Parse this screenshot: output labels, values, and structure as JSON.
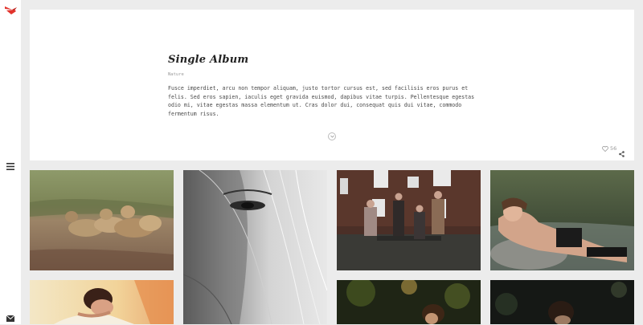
{
  "sidebar": {
    "logo_icon": "bird-logo-icon",
    "menu_icon": "hamburger-menu-icon",
    "contact_icon": "envelope-icon",
    "accent_color": "#e2332c"
  },
  "album": {
    "title": "Single Album",
    "category": "Nature",
    "description": "Fusce imperdiet, arcu non tempor aliquam, justo tortor cursus est, sed facilisis eros purus et felis. Sed eros sapien, iaculis eget gravida euismod, dapibus vitae turpis. Pellentesque egestas odio mi, vitae egestas massa elementum ut. Cras dolor dui, consequat quis dui vitae, commodo fermentum risus.",
    "likes": "56",
    "like_icon": "heart-outline-icon",
    "share_icon": "share-icon",
    "scroll_icon": "chevron-down-circle-icon"
  },
  "gallery": {
    "photos": [
      "lions-on-dirt-road",
      "woman-face-black-and-white",
      "group-of-five-people-on-bench",
      "woman-lying-on-rock-by-water",
      "woman-lying-in-sunlight",
      "woman-in-forest-light",
      "portrait-in-dark-setting"
    ]
  }
}
